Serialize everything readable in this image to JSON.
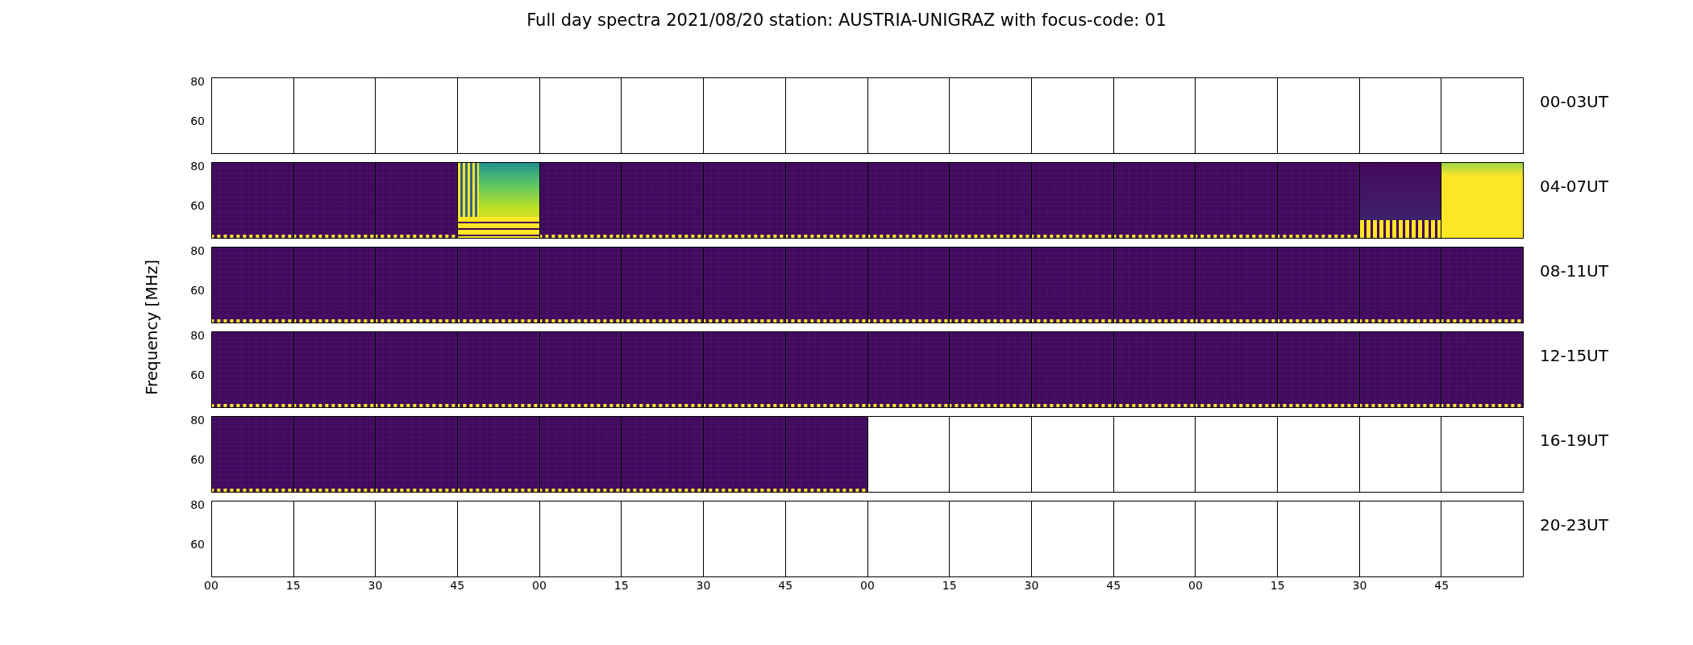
{
  "figure": {
    "title": "Full day spectra 2021/08/20 station: AUSTRIA-UNIGRAZ with focus-code: 01",
    "ylabel": "Frequency [MHz]",
    "rows": [
      {
        "label": "00-03UT",
        "yticks": [
          "80",
          "60"
        ],
        "panels": [
          {
            "kind": "empty"
          },
          {
            "kind": "empty"
          },
          {
            "kind": "empty"
          },
          {
            "kind": "empty"
          },
          {
            "kind": "empty"
          },
          {
            "kind": "empty"
          },
          {
            "kind": "empty"
          },
          {
            "kind": "empty"
          },
          {
            "kind": "empty"
          },
          {
            "kind": "empty"
          },
          {
            "kind": "empty"
          },
          {
            "kind": "empty"
          },
          {
            "kind": "empty"
          },
          {
            "kind": "empty"
          },
          {
            "kind": "empty"
          },
          {
            "kind": "empty"
          }
        ]
      },
      {
        "label": "04-07UT",
        "yticks": [
          "80",
          "60"
        ],
        "panels": [
          {
            "kind": "spectrum"
          },
          {
            "kind": "spectrum"
          },
          {
            "kind": "spectrum"
          },
          {
            "kind": "burst"
          },
          {
            "kind": "spectrum"
          },
          {
            "kind": "spectrum"
          },
          {
            "kind": "spectrum"
          },
          {
            "kind": "spectrum"
          },
          {
            "kind": "spectrum"
          },
          {
            "kind": "spectrum"
          },
          {
            "kind": "spectrum"
          },
          {
            "kind": "spectrum"
          },
          {
            "kind": "spectrum"
          },
          {
            "kind": "spectrum"
          },
          {
            "kind": "lowband"
          },
          {
            "kind": "saturated"
          }
        ]
      },
      {
        "label": "08-11UT",
        "yticks": [
          "80",
          "60"
        ],
        "panels": [
          {
            "kind": "spectrum"
          },
          {
            "kind": "spectrum"
          },
          {
            "kind": "spectrum"
          },
          {
            "kind": "spectrum"
          },
          {
            "kind": "spectrum"
          },
          {
            "kind": "spectrum"
          },
          {
            "kind": "spectrum"
          },
          {
            "kind": "spectrum"
          },
          {
            "kind": "spectrum"
          },
          {
            "kind": "spectrum"
          },
          {
            "kind": "spectrum"
          },
          {
            "kind": "spectrum"
          },
          {
            "kind": "spectrum"
          },
          {
            "kind": "spectrum"
          },
          {
            "kind": "spectrum"
          },
          {
            "kind": "spectrum"
          }
        ]
      },
      {
        "label": "12-15UT",
        "yticks": [
          "80",
          "60"
        ],
        "panels": [
          {
            "kind": "spectrum"
          },
          {
            "kind": "spectrum"
          },
          {
            "kind": "spectrum"
          },
          {
            "kind": "spectrum"
          },
          {
            "kind": "spectrum"
          },
          {
            "kind": "spectrum"
          },
          {
            "kind": "spectrum"
          },
          {
            "kind": "spectrum"
          },
          {
            "kind": "spectrum"
          },
          {
            "kind": "spectrum"
          },
          {
            "kind": "spectrum"
          },
          {
            "kind": "spectrum"
          },
          {
            "kind": "spectrum"
          },
          {
            "kind": "spectrum"
          },
          {
            "kind": "spectrum"
          },
          {
            "kind": "spectrum"
          }
        ]
      },
      {
        "label": "16-19UT",
        "yticks": [
          "80",
          "60"
        ],
        "panels": [
          {
            "kind": "spectrum"
          },
          {
            "kind": "spectrum"
          },
          {
            "kind": "spectrum"
          },
          {
            "kind": "spectrum"
          },
          {
            "kind": "spectrum"
          },
          {
            "kind": "spectrum"
          },
          {
            "kind": "spectrum"
          },
          {
            "kind": "spectrum"
          },
          {
            "kind": "empty"
          },
          {
            "kind": "empty"
          },
          {
            "kind": "empty"
          },
          {
            "kind": "empty"
          },
          {
            "kind": "empty"
          },
          {
            "kind": "empty"
          },
          {
            "kind": "empty"
          },
          {
            "kind": "empty"
          }
        ]
      },
      {
        "label": "20-23UT",
        "yticks": [
          "80",
          "60"
        ],
        "panels": [
          {
            "kind": "empty"
          },
          {
            "kind": "empty"
          },
          {
            "kind": "empty"
          },
          {
            "kind": "empty"
          },
          {
            "kind": "empty"
          },
          {
            "kind": "empty"
          },
          {
            "kind": "empty"
          },
          {
            "kind": "empty"
          },
          {
            "kind": "empty"
          },
          {
            "kind": "empty"
          },
          {
            "kind": "empty"
          },
          {
            "kind": "empty"
          },
          {
            "kind": "empty"
          },
          {
            "kind": "empty"
          },
          {
            "kind": "empty"
          },
          {
            "kind": "empty"
          }
        ]
      }
    ],
    "xticks": [
      "00",
      "15",
      "30",
      "45",
      "00",
      "15",
      "30",
      "45",
      "00",
      "15",
      "30",
      "45",
      "00",
      "15",
      "30",
      "45"
    ]
  }
}
